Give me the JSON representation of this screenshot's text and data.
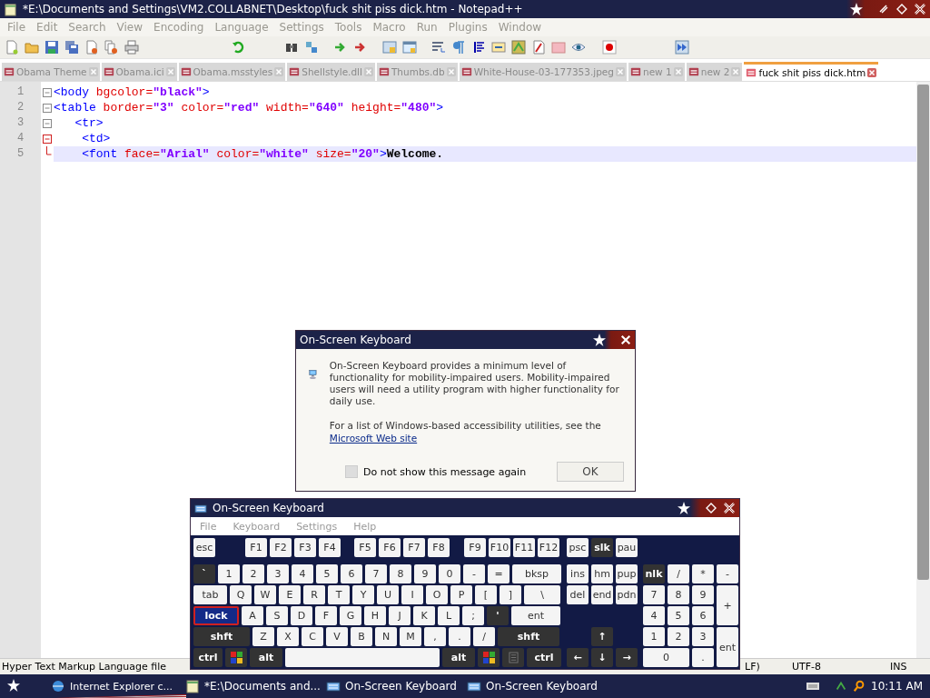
{
  "window": {
    "title": "*E:\\Documents and Settings\\VM2.COLLABNET\\Desktop\\fuck shit piss dick.htm - Notepad++"
  },
  "menu": [
    "File",
    "Edit",
    "Search",
    "View",
    "Encoding",
    "Language",
    "Settings",
    "Tools",
    "Macro",
    "Run",
    "Plugins",
    "Window"
  ],
  "tabs": [
    {
      "label": "Obama Theme",
      "selected": false
    },
    {
      "label": "Obama.ici",
      "selected": false
    },
    {
      "label": "Obama.msstyles",
      "selected": false
    },
    {
      "label": "Shellstyle.dll",
      "selected": false
    },
    {
      "label": "Thumbs.db",
      "selected": false
    },
    {
      "label": "White-House-03-177353.jpeg",
      "selected": false
    },
    {
      "label": "new 1",
      "selected": false
    },
    {
      "label": "new 2",
      "selected": false
    },
    {
      "label": "fuck shit piss dick.htm",
      "selected": true
    }
  ],
  "editor": {
    "lines": [
      {
        "number": "1",
        "fold_start": true,
        "fold_highlight": false,
        "current": false,
        "tokens": [
          {
            "kind": "tag",
            "text": "<body"
          },
          {
            "kind": "attr",
            "text": " bgcolor="
          },
          {
            "kind": "string",
            "text": "\"black\""
          },
          {
            "kind": "tag",
            "text": ">"
          }
        ]
      },
      {
        "number": "2",
        "fold_start": true,
        "fold_highlight": false,
        "current": false,
        "tokens": [
          {
            "kind": "tag",
            "text": "<table"
          },
          {
            "kind": "attr",
            "text": " border="
          },
          {
            "kind": "string",
            "text": "\"3\""
          },
          {
            "kind": "attr",
            "text": " color="
          },
          {
            "kind": "string",
            "text": "\"red\""
          },
          {
            "kind": "attr",
            "text": " width="
          },
          {
            "kind": "string",
            "text": "\"640\""
          },
          {
            "kind": "attr",
            "text": " height="
          },
          {
            "kind": "string",
            "text": "\"480\""
          },
          {
            "kind": "tag",
            "text": ">"
          }
        ]
      },
      {
        "number": "3",
        "fold_start": true,
        "fold_highlight": false,
        "current": false,
        "tokens": [
          {
            "kind": "tag",
            "text": "   <tr>"
          }
        ]
      },
      {
        "number": "4",
        "fold_start": true,
        "fold_highlight": true,
        "current": false,
        "tokens": [
          {
            "kind": "tag",
            "text": "    <td>"
          }
        ]
      },
      {
        "number": "5",
        "fold_start": false,
        "fold_highlight": true,
        "current": true,
        "tokens": [
          {
            "kind": "tag",
            "text": "    <font"
          },
          {
            "kind": "attr",
            "text": " face="
          },
          {
            "kind": "string",
            "text": "\"Arial\""
          },
          {
            "kind": "attr",
            "text": " color="
          },
          {
            "kind": "string",
            "text": "\"white\""
          },
          {
            "kind": "attr",
            "text": " size="
          },
          {
            "kind": "string",
            "text": "\"20\""
          },
          {
            "kind": "tag",
            "text": ">"
          },
          {
            "kind": "text",
            "text": "Welcome."
          }
        ]
      }
    ]
  },
  "status_bar": [
    "Hyper Text Markup Language file",
    "LF)",
    "UTF-8",
    "INS"
  ],
  "dialog": {
    "title": "On-Screen Keyboard",
    "paragraph": "On-Screen Keyboard provides a minimum level of functionality for mobility-impaired users. Mobility-impaired users will need a utility program with higher functionality for daily use.",
    "list_text": "For a list of Windows-based accessibility utilities, see the",
    "link": "Microsoft Web site",
    "checkbox": {
      "label": "Do not show this message again",
      "checked": false
    },
    "button": "OK"
  },
  "keyboard": {
    "title": "On-Screen Keyboard",
    "menu": [
      "File",
      "Keyboard",
      "Settings",
      "Help"
    ],
    "rows": [
      {
        "keys": [
          {
            "label": "esc",
            "kind": "light"
          },
          {
            "label": "F1",
            "kind": "light"
          },
          {
            "label": "F2",
            "kind": "light"
          },
          {
            "label": "F3",
            "kind": "light"
          },
          {
            "label": "F4",
            "kind": "light"
          },
          {
            "label": "F5",
            "kind": "light"
          },
          {
            "label": "F6",
            "kind": "light"
          },
          {
            "label": "F7",
            "kind": "light"
          },
          {
            "label": "F8",
            "kind": "light"
          },
          {
            "label": "F9",
            "kind": "light"
          },
          {
            "label": "F10",
            "kind": "light"
          },
          {
            "label": "F11",
            "kind": "light"
          },
          {
            "label": "F12",
            "kind": "light"
          }
        ]
      },
      {
        "keys": [
          {
            "label": "`",
            "kind": "dark"
          },
          {
            "label": "1",
            "kind": "light"
          },
          {
            "label": "2",
            "kind": "light"
          },
          {
            "label": "3",
            "kind": "light"
          },
          {
            "label": "4",
            "kind": "light"
          },
          {
            "label": "5",
            "kind": "light"
          },
          {
            "label": "6",
            "kind": "light"
          },
          {
            "label": "7",
            "kind": "light"
          },
          {
            "label": "8",
            "kind": "light"
          },
          {
            "label": "9",
            "kind": "light"
          },
          {
            "label": "0",
            "kind": "light"
          },
          {
            "label": "-",
            "kind": "light"
          },
          {
            "label": "=",
            "kind": "light"
          },
          {
            "label": "bksp",
            "kind": "light"
          }
        ]
      },
      {
        "keys": [
          {
            "label": "tab",
            "kind": "light"
          },
          {
            "label": "Q",
            "kind": "light"
          },
          {
            "label": "W",
            "kind": "light"
          },
          {
            "label": "E",
            "kind": "light"
          },
          {
            "label": "R",
            "kind": "light"
          },
          {
            "label": "T",
            "kind": "light"
          },
          {
            "label": "Y",
            "kind": "light"
          },
          {
            "label": "U",
            "kind": "light"
          },
          {
            "label": "I",
            "kind": "light"
          },
          {
            "label": "O",
            "kind": "light"
          },
          {
            "label": "P",
            "kind": "light"
          },
          {
            "label": "[",
            "kind": "light"
          },
          {
            "label": "]",
            "kind": "light"
          },
          {
            "label": "\\",
            "kind": "light"
          }
        ]
      },
      {
        "keys": [
          {
            "label": "lock",
            "kind": "pressed"
          },
          {
            "label": "A",
            "kind": "light"
          },
          {
            "label": "S",
            "kind": "light"
          },
          {
            "label": "D",
            "kind": "light"
          },
          {
            "label": "F",
            "kind": "light"
          },
          {
            "label": "G",
            "kind": "light"
          },
          {
            "label": "H",
            "kind": "light"
          },
          {
            "label": "J",
            "kind": "light"
          },
          {
            "label": "K",
            "kind": "light"
          },
          {
            "label": "L",
            "kind": "light"
          },
          {
            "label": ";",
            "kind": "light"
          },
          {
            "label": "'",
            "kind": "dark"
          },
          {
            "label": "ent",
            "kind": "light"
          }
        ]
      },
      {
        "keys": [
          {
            "label": "shft",
            "kind": "dark"
          },
          {
            "label": "Z",
            "kind": "light"
          },
          {
            "label": "X",
            "kind": "light"
          },
          {
            "label": "C",
            "kind": "light"
          },
          {
            "label": "V",
            "kind": "light"
          },
          {
            "label": "B",
            "kind": "light"
          },
          {
            "label": "N",
            "kind": "light"
          },
          {
            "label": "M",
            "kind": "light"
          },
          {
            "label": ",",
            "kind": "light"
          },
          {
            "label": ".",
            "kind": "light"
          },
          {
            "label": "/",
            "kind": "light"
          },
          {
            "label": "shft",
            "kind": "dark"
          }
        ]
      },
      {
        "keys": [
          {
            "label": "ctrl",
            "kind": "dark"
          },
          {
            "kind": "win"
          },
          {
            "label": "alt",
            "kind": "dark"
          },
          {
            "kind": "space"
          },
          {
            "label": "alt",
            "kind": "dark"
          },
          {
            "kind": "win"
          },
          {
            "kind": "menu"
          },
          {
            "label": "ctrl",
            "kind": "dark"
          }
        ]
      }
    ],
    "nav": [
      [
        {
          "label": "psc",
          "kind": "light"
        },
        {
          "label": "slk",
          "kind": "dark"
        },
        {
          "label": "pau",
          "kind": "light"
        }
      ],
      [
        {
          "label": "ins",
          "kind": "light"
        },
        {
          "label": "hm",
          "kind": "light"
        },
        {
          "label": "pup",
          "kind": "light"
        }
      ],
      [
        {
          "label": "del",
          "kind": "light"
        },
        {
          "label": "end",
          "kind": "light"
        },
        {
          "label": "pdn",
          "kind": "light"
        }
      ],
      [
        {
          "kind": "blank"
        },
        {
          "kind": "blank"
        },
        {
          "kind": "blank"
        }
      ],
      [
        {
          "kind": "blank"
        },
        {
          "label": "↑",
          "kind": "dark"
        },
        {
          "kind": "blank"
        }
      ],
      [
        {
          "label": "←",
          "kind": "dark"
        },
        {
          "label": "↓",
          "kind": "dark"
        },
        {
          "label": "→",
          "kind": "dark"
        }
      ]
    ],
    "numpad": [
      {
        "label": "nlk",
        "kind": "dark"
      },
      {
        "label": "/",
        "kind": "light"
      },
      {
        "label": "*",
        "kind": "light"
      },
      {
        "label": "-",
        "kind": "light"
      },
      {
        "label": "7",
        "kind": "light"
      },
      {
        "label": "8",
        "kind": "light"
      },
      {
        "label": "9",
        "kind": "light"
      },
      {
        "label": "+",
        "kind": "light"
      },
      {
        "label": "4",
        "kind": "light"
      },
      {
        "label": "5",
        "kind": "light"
      },
      {
        "label": "6",
        "kind": "light"
      },
      {
        "label": "1",
        "kind": "light"
      },
      {
        "label": "2",
        "kind": "light"
      },
      {
        "label": "3",
        "kind": "light"
      },
      {
        "label": "ent",
        "kind": "light"
      },
      {
        "label": "0",
        "kind": "light"
      },
      {
        "label": ".",
        "kind": "light"
      }
    ]
  },
  "taskbar": {
    "items": [
      {
        "label": "Internet Explorer c...",
        "kind": "browser"
      },
      {
        "label": "*E:\\Documents and...",
        "kind": "notepad"
      },
      {
        "label": "On-Screen Keyboard",
        "kind": "keyboard"
      },
      {
        "label": "On-Screen Keyboard",
        "kind": "keyboard"
      }
    ],
    "clock": "10:11 AM"
  }
}
